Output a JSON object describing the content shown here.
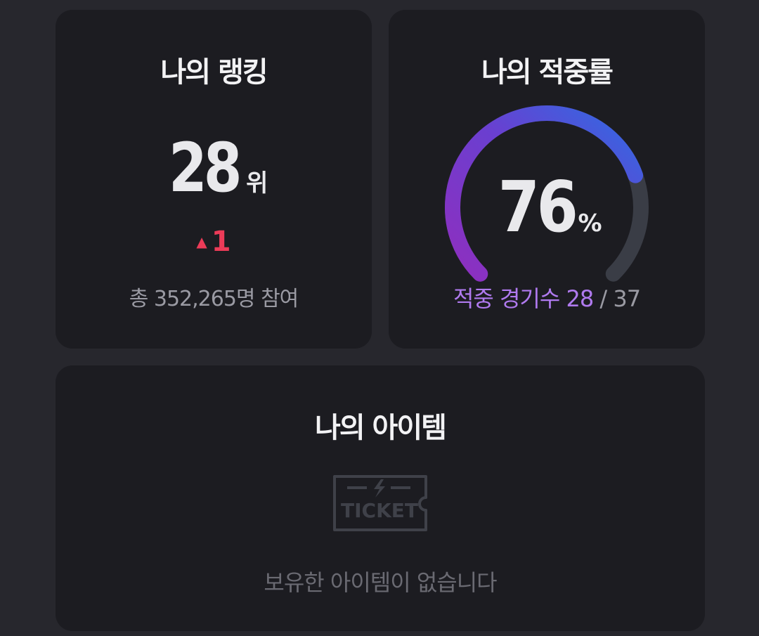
{
  "ranking": {
    "title": "나의 랭킹",
    "rank": "28",
    "rank_unit": "위",
    "change_arrow": "▲",
    "change": "1",
    "participants_text": "총 352,265명 참여"
  },
  "accuracy": {
    "title": "나의 적중률",
    "percent": "76",
    "percent_fraction": 0.76,
    "percent_unit": "%",
    "hits_label": "적중 경기수",
    "hits": "28",
    "separator": "/",
    "total": "37"
  },
  "items": {
    "title": "나의 아이템",
    "ticket_icon": "ticket-icon",
    "ticket_text": "TICKET",
    "empty_text": "보유한 아이템이 없습니다"
  },
  "colors": {
    "background": "#27272d",
    "card": "#1c1c21",
    "accent_rank_up": "#ec3b58",
    "accent_purple": "#b07aef",
    "gauge_start": "#8e2fbf",
    "gauge_end": "#2f6be3",
    "gauge_track": "#3a3d46"
  }
}
